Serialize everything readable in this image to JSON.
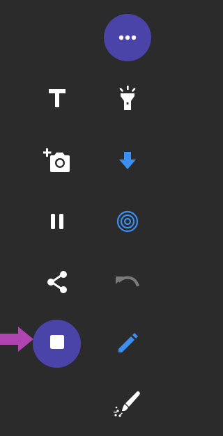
{
  "colors": {
    "background": "#2b2b2b",
    "fab": "#4b44a8",
    "icon_white": "#ffffff",
    "icon_blue": "#3b8ff0",
    "icon_disabled": "#7a7a7a",
    "pointer": "#b044b0"
  },
  "toolbar": {
    "more_button": {
      "icon": "more-horizontal-icon"
    },
    "tools": [
      {
        "id": "text",
        "icon": "text-T-icon",
        "color": "white"
      },
      {
        "id": "flashlight",
        "icon": "flashlight-icon",
        "color": "white"
      },
      {
        "id": "add-photo",
        "icon": "camera-add-icon",
        "color": "white"
      },
      {
        "id": "download",
        "icon": "arrow-down-icon",
        "color": "blue"
      },
      {
        "id": "pause",
        "icon": "pause-icon",
        "color": "white"
      },
      {
        "id": "target",
        "icon": "concentric-circles-icon",
        "color": "blue"
      },
      {
        "id": "share",
        "icon": "share-icon",
        "color": "white"
      },
      {
        "id": "undo",
        "icon": "undo-icon",
        "color": "disabled"
      },
      {
        "id": "stop-recording",
        "icon": "stop-square-icon",
        "color": "white"
      },
      {
        "id": "pencil",
        "icon": "pencil-icon",
        "color": "blue"
      },
      {
        "id": "sparkle-brush",
        "icon": "sparkle-brush-icon",
        "color": "white"
      }
    ],
    "pointer": {
      "icon": "arrow-right-pointer-icon"
    }
  }
}
